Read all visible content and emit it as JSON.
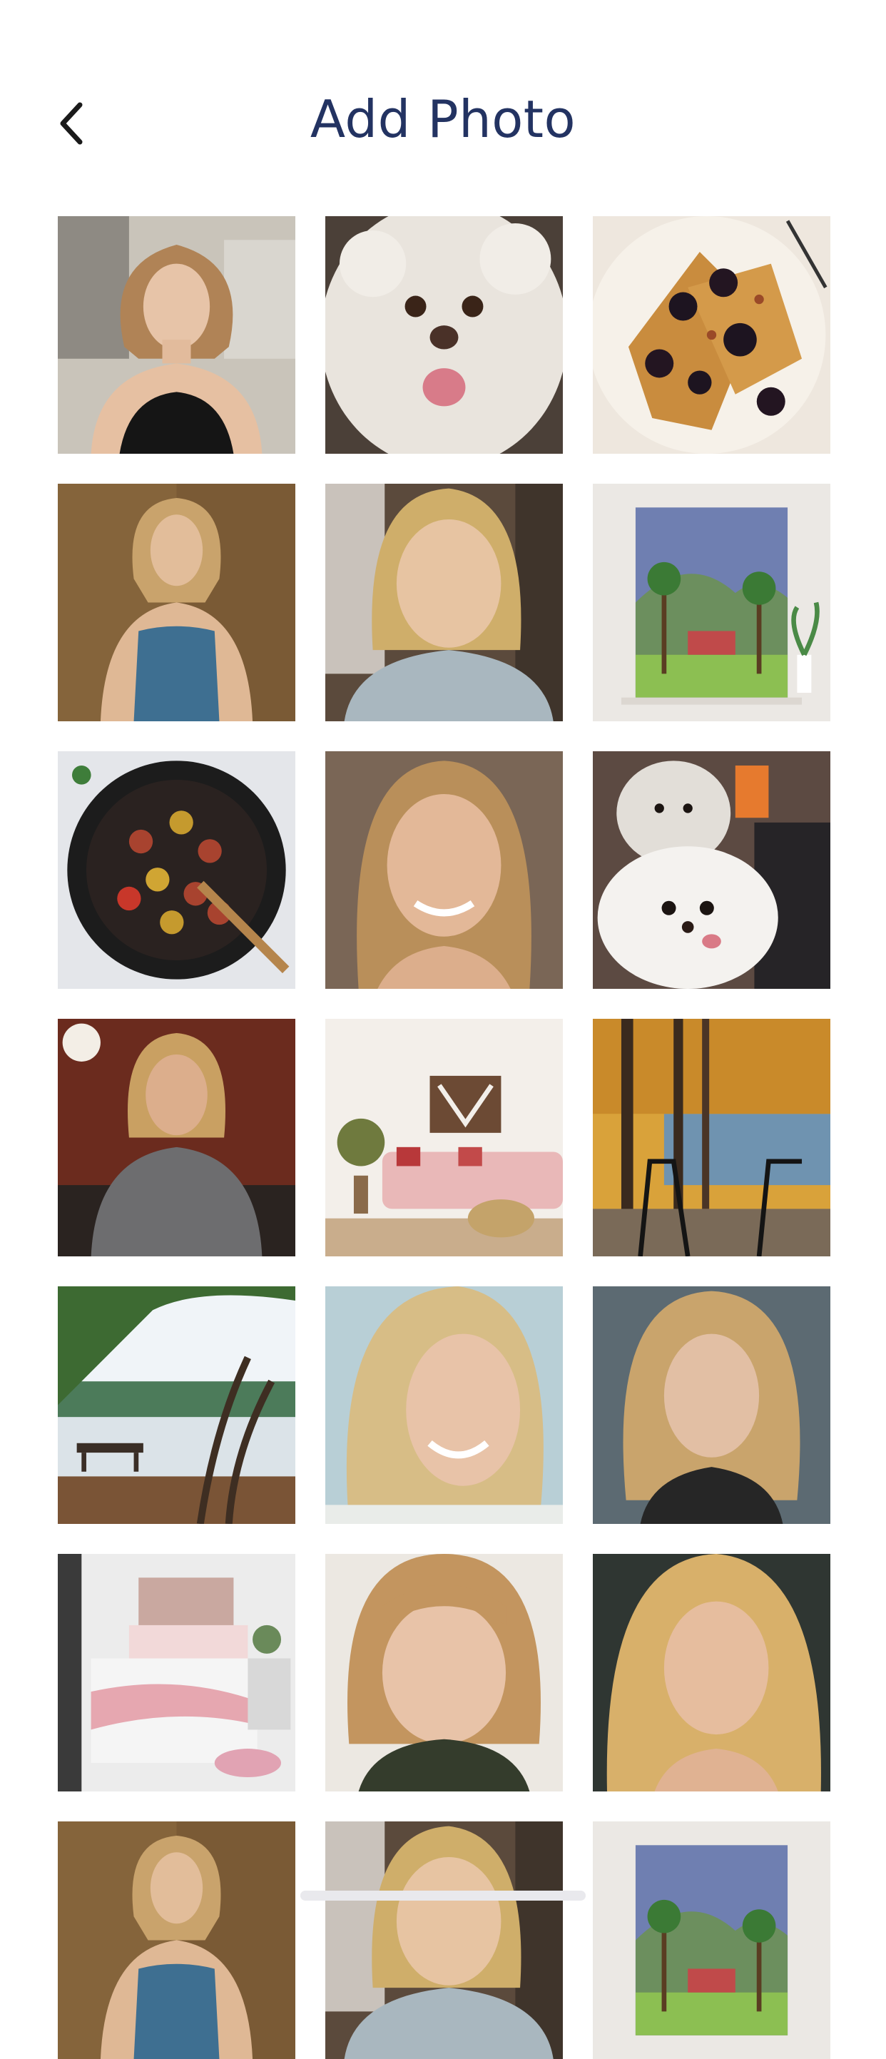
{
  "header": {
    "title": "Add Photo",
    "back_icon": "chevron-left-icon"
  },
  "colors": {
    "title": "#233362",
    "background": "#ffffff",
    "back_icon": "#1a1a1a"
  },
  "photos": [
    {
      "name": "photo-woman-black-top",
      "subject": "portrait"
    },
    {
      "name": "photo-white-poodle",
      "subject": "dog"
    },
    {
      "name": "photo-french-toast-berries",
      "subject": "food"
    },
    {
      "name": "photo-woman-blue-tank",
      "subject": "portrait"
    },
    {
      "name": "photo-woman-selfie",
      "subject": "portrait"
    },
    {
      "name": "photo-tropical-painting",
      "subject": "art"
    },
    {
      "name": "photo-sausage-skillet",
      "subject": "food"
    },
    {
      "name": "photo-woman-smiling",
      "subject": "portrait"
    },
    {
      "name": "photo-two-dogs",
      "subject": "dog"
    },
    {
      "name": "photo-woman-gray-shirt",
      "subject": "portrait"
    },
    {
      "name": "photo-pink-living-room",
      "subject": "interior"
    },
    {
      "name": "photo-autumn-lake",
      "subject": "landscape"
    },
    {
      "name": "photo-lake-bench",
      "subject": "landscape"
    },
    {
      "name": "photo-woman-curly-smile",
      "subject": "portrait"
    },
    {
      "name": "photo-woman-curly-serious",
      "subject": "portrait"
    },
    {
      "name": "photo-bedroom",
      "subject": "interior"
    },
    {
      "name": "photo-woman-bangs",
      "subject": "portrait"
    },
    {
      "name": "photo-woman-long-hair",
      "subject": "portrait"
    },
    {
      "name": "photo-woman-blue-tank-2",
      "subject": "portrait"
    },
    {
      "name": "photo-woman-selfie-2",
      "subject": "portrait"
    },
    {
      "name": "photo-tropical-painting-2",
      "subject": "art"
    }
  ]
}
